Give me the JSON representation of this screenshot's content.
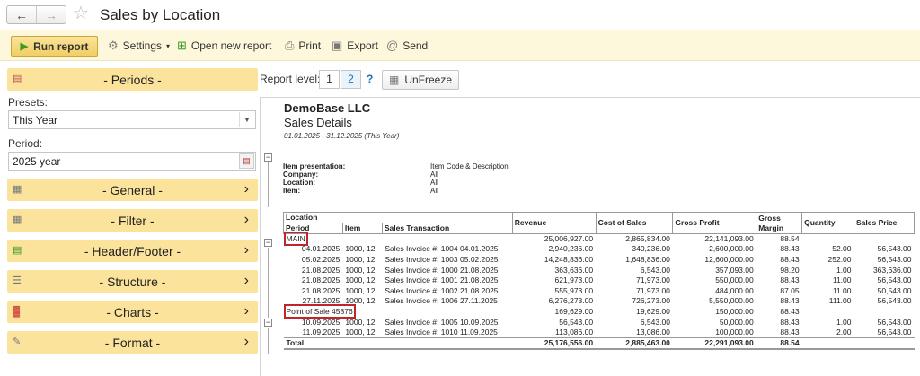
{
  "header": {
    "title": "Sales by Location"
  },
  "toolbar": {
    "run": "Run report",
    "settings": "Settings",
    "new_report": "Open new report",
    "print": "Print",
    "export": "Export",
    "send": "Send"
  },
  "sidebar": {
    "periods": "- Periods -",
    "presets_label": "Presets:",
    "presets_value": "This Year",
    "period_label": "Period:",
    "period_value": "2025 year",
    "general": "- General -",
    "filter": "- Filter -",
    "header_footer": "- Header/Footer -",
    "structure": "- Structure -",
    "charts": "- Charts -",
    "format": "- Format -"
  },
  "report_level": {
    "label": "Report level:",
    "levels": [
      "1",
      "2"
    ],
    "help": "?",
    "unfreeze": "UnFreeze"
  },
  "report": {
    "company": "DemoBase LLC",
    "subtitle": "Sales Details",
    "range": "01.01.2025 - 31.12.2025 (This Year)",
    "params": [
      {
        "key": "Item presentation:",
        "value": "Item Code & Description"
      },
      {
        "key": "Company:",
        "value": "All"
      },
      {
        "key": "Location:",
        "value": "All"
      },
      {
        "key": "Item:",
        "value": "All"
      }
    ],
    "headers": {
      "location": "Location",
      "period": "Period",
      "item": "Item",
      "transaction": "Sales Transaction",
      "revenue": "Revenue",
      "cost": "Cost of Sales",
      "gross_profit": "Gross Profit",
      "gross_margin": "Gross Margin",
      "quantity": "Quantity",
      "price": "Sales Price"
    },
    "groups": [
      {
        "name": "MAIN",
        "revenue": "25,006,927.00",
        "cost": "2,865,834.00",
        "profit": "22,141,093.00",
        "margin": "88.54",
        "rows": [
          {
            "period": "04.01.2025",
            "item": "1000, 12",
            "trx": "Sales Invoice #: 1004 04.01.2025",
            "revenue": "2,940,236.00",
            "cost": "340,236.00",
            "profit": "2,600,000.00",
            "margin": "88.43",
            "qty": "52.00",
            "price": "56,543.00"
          },
          {
            "period": "05.02.2025",
            "item": "1000, 12",
            "trx": "Sales Invoice #: 1003 05.02.2025",
            "revenue": "14,248,836.00",
            "cost": "1,648,836.00",
            "profit": "12,600,000.00",
            "margin": "88.43",
            "qty": "252.00",
            "price": "56,543.00"
          },
          {
            "period": "21.08.2025",
            "item": "1000, 12",
            "trx": "Sales Invoice #: 1000 21.08.2025",
            "revenue": "363,636.00",
            "cost": "6,543.00",
            "profit": "357,093.00",
            "margin": "98.20",
            "qty": "1.00",
            "price": "363,636.00"
          },
          {
            "period": "21.08.2025",
            "item": "1000, 12",
            "trx": "Sales Invoice #: 1001 21.08.2025",
            "revenue": "621,973.00",
            "cost": "71,973.00",
            "profit": "550,000.00",
            "margin": "88.43",
            "qty": "11.00",
            "price": "56,543.00"
          },
          {
            "period": "21.08.2025",
            "item": "1000, 12",
            "trx": "Sales Invoice #: 1002 21.08.2025",
            "revenue": "555,973.00",
            "cost": "71,973.00",
            "profit": "484,000.00",
            "margin": "87.05",
            "qty": "11.00",
            "price": "50,543.00"
          },
          {
            "period": "27.11.2025",
            "item": "1000, 12",
            "trx": "Sales Invoice #: 1006 27.11.2025",
            "revenue": "6,276,273.00",
            "cost": "726,273.00",
            "profit": "5,550,000.00",
            "margin": "88.43",
            "qty": "111.00",
            "price": "56,543.00"
          }
        ]
      },
      {
        "name": "Point of Sale 45876",
        "revenue": "169,629.00",
        "cost": "19,629.00",
        "profit": "150,000.00",
        "margin": "88.43",
        "rows": [
          {
            "period": "10.09.2025",
            "item": "1000, 12",
            "trx": "Sales Invoice #: 1005 10.09.2025",
            "revenue": "56,543.00",
            "cost": "6,543.00",
            "profit": "50,000.00",
            "margin": "88.43",
            "qty": "1.00",
            "price": "56,543.00"
          },
          {
            "period": "11.09.2025",
            "item": "1000, 12",
            "trx": "Sales Invoice #: 1010 11.09.2025",
            "revenue": "113,086.00",
            "cost": "13,086.00",
            "profit": "100,000.00",
            "margin": "88.43",
            "qty": "2.00",
            "price": "56,543.00"
          }
        ]
      }
    ],
    "total": {
      "label": "Total",
      "revenue": "25,176,556.00",
      "cost": "2,885,463.00",
      "profit": "22,291,093.00",
      "margin": "88.54"
    }
  }
}
